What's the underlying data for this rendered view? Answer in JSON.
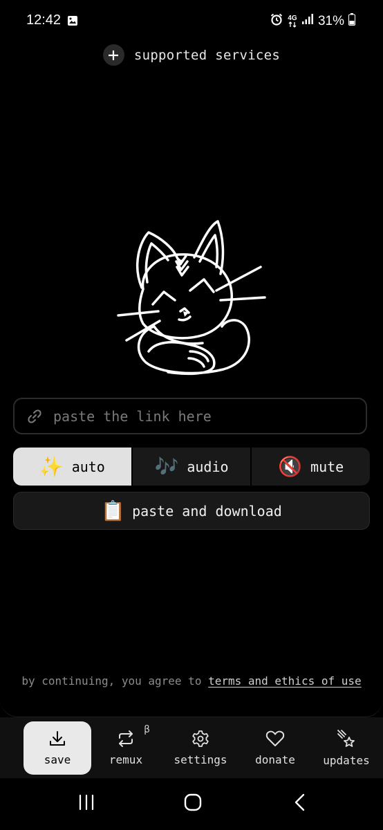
{
  "status_bar": {
    "time": "12:42",
    "network": "4G",
    "battery": "31%"
  },
  "header": {
    "supported_services_label": "supported services"
  },
  "input": {
    "placeholder": "paste the link here"
  },
  "modes": [
    {
      "emoji": "✨",
      "label": "auto",
      "active": true
    },
    {
      "emoji": "🎶",
      "label": "audio",
      "active": false
    },
    {
      "emoji": "🔇",
      "label": "mute",
      "active": false
    }
  ],
  "download": {
    "emoji": "📋",
    "label": "paste and download"
  },
  "terms": {
    "prefix": "by continuing, you agree to ",
    "link": "terms and ethics of use"
  },
  "tabs": [
    {
      "label": "save",
      "icon": "download-icon",
      "active": true
    },
    {
      "label": "remux",
      "icon": "repeat-icon",
      "badge": "β"
    },
    {
      "label": "settings",
      "icon": "gear-icon"
    },
    {
      "label": "donate",
      "icon": "heart-icon"
    },
    {
      "label": "updates",
      "icon": "comet-icon"
    }
  ],
  "colors": {
    "background": "#000000",
    "surface": "#191919",
    "active": "#e1e1e1",
    "text": "#e1e1e1",
    "muted_text": "#8c8c8c"
  }
}
